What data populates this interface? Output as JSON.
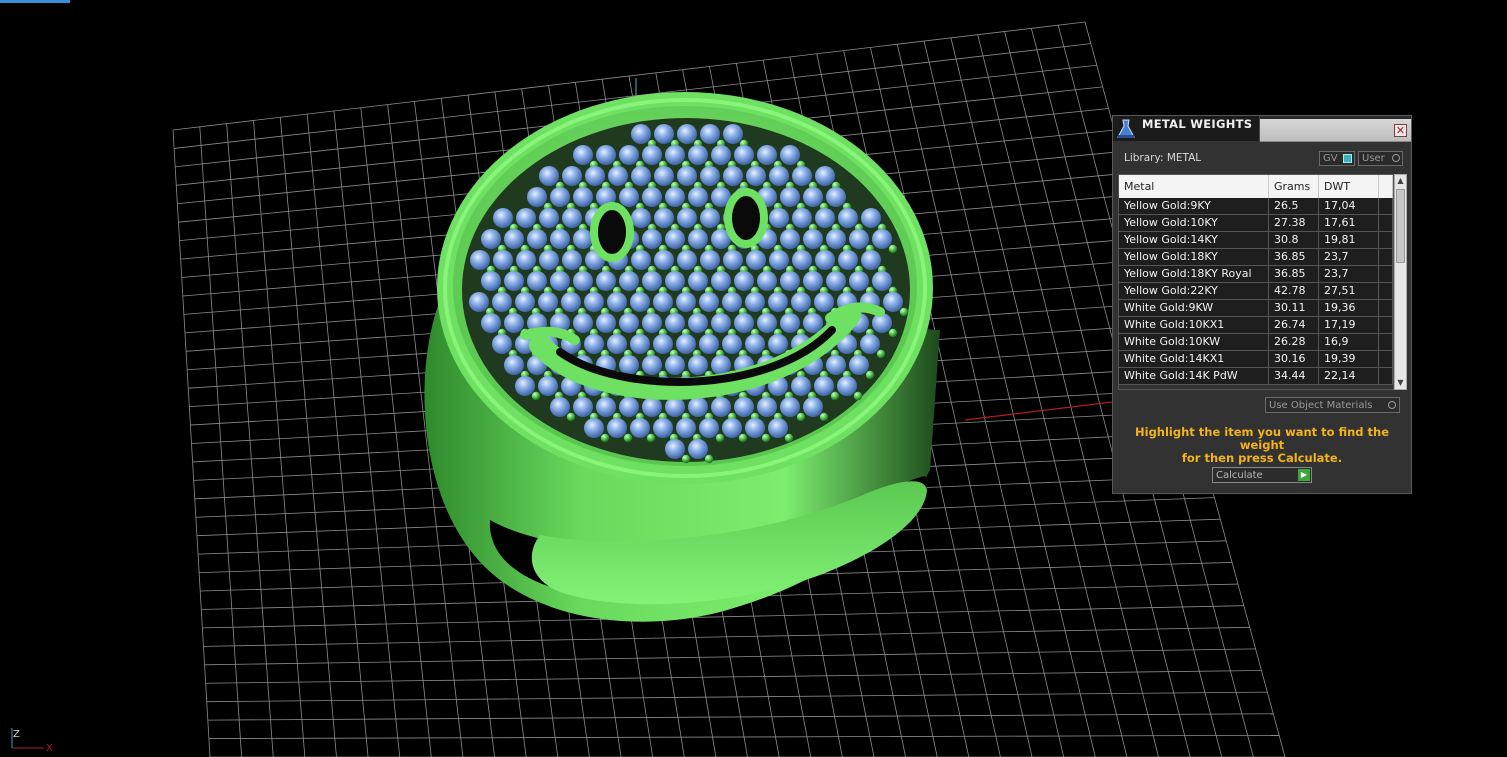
{
  "panel": {
    "title": "METAL WEIGHTS",
    "close_label": "✕",
    "library_label": "Library: METAL",
    "gv_label": "GV",
    "user_label": "User",
    "columns": [
      "Metal",
      "Grams",
      "DWT"
    ],
    "rows": [
      {
        "metal": "Yellow Gold:9KY",
        "grams": "26.5",
        "dwt": "17,04"
      },
      {
        "metal": "Yellow Gold:10KY",
        "grams": "27.38",
        "dwt": "17,61"
      },
      {
        "metal": "Yellow Gold:14KY",
        "grams": "30.8",
        "dwt": "19,81"
      },
      {
        "metal": "Yellow Gold:18KY",
        "grams": "36.85",
        "dwt": "23,7"
      },
      {
        "metal": "Yellow Gold:18KY Royal",
        "grams": "36.85",
        "dwt": "23,7"
      },
      {
        "metal": "Yellow Gold:22KY",
        "grams": "42.78",
        "dwt": "27,51"
      },
      {
        "metal": "White Gold:9KW",
        "grams": "30.11",
        "dwt": "19,36"
      },
      {
        "metal": "White Gold:10KX1",
        "grams": "26.74",
        "dwt": "17,19"
      },
      {
        "metal": "White Gold:10KW",
        "grams": "26.28",
        "dwt": "16,9"
      },
      {
        "metal": "White Gold:14KX1",
        "grams": "30.16",
        "dwt": "19,39"
      },
      {
        "metal": "White Gold:14K PdW",
        "grams": "34.44",
        "dwt": "22,14"
      }
    ],
    "use_object_materials_label": "Use Object Materials",
    "hint_line1": "Highlight the item you want to find the weight",
    "hint_line2": "for then press Calculate.",
    "calculate_label": "Calculate"
  },
  "axes": {
    "z_label": "Z",
    "x_label": "X"
  },
  "colors": {
    "ring": "#77e86a",
    "gem": "#7fa8e6",
    "grid": "#9a9a9a",
    "hint": "#f2b31b"
  }
}
